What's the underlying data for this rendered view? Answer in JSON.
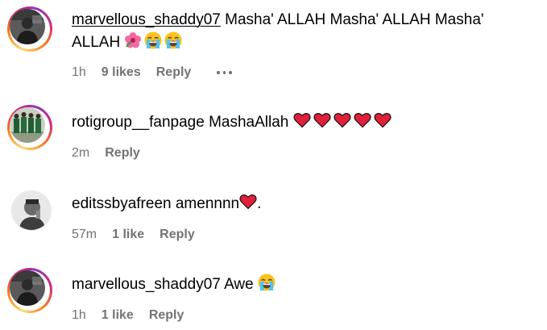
{
  "comments": [
    {
      "username": "marvellous_shaddy07",
      "text": " Masha' ALLAH Masha' ALLAH Masha'",
      "text_line2": "ALLAH ",
      "emojis": [
        "hibiscus-icon",
        "loudly-crying-face-icon",
        "loudly-crying-face-icon"
      ],
      "time": "1h",
      "likes": "9 likes",
      "reply": "Reply",
      "has_more": true
    },
    {
      "username": "rotigroup__fanpage",
      "text": " MashaAllah ",
      "emojis": [
        "heart-icon",
        "heart-icon",
        "heart-icon",
        "heart-icon",
        "heart-icon"
      ],
      "time": "2m",
      "reply": "Reply"
    },
    {
      "username": "editssbyafreen",
      "text": " amennnn",
      "trailing": ".",
      "emojis": [
        "heart-icon"
      ],
      "time": "57m",
      "likes": "1 like",
      "reply": "Reply"
    },
    {
      "username": "marvellous_shaddy07",
      "text": " Awe ",
      "emojis": [
        "loudly-crying-face-icon"
      ],
      "time": "1h",
      "likes": "1 like",
      "reply": "Reply"
    }
  ],
  "colors": {
    "meta_gray": "#737373",
    "heart_red": "#e0203a",
    "story_ring": "#d62976"
  }
}
